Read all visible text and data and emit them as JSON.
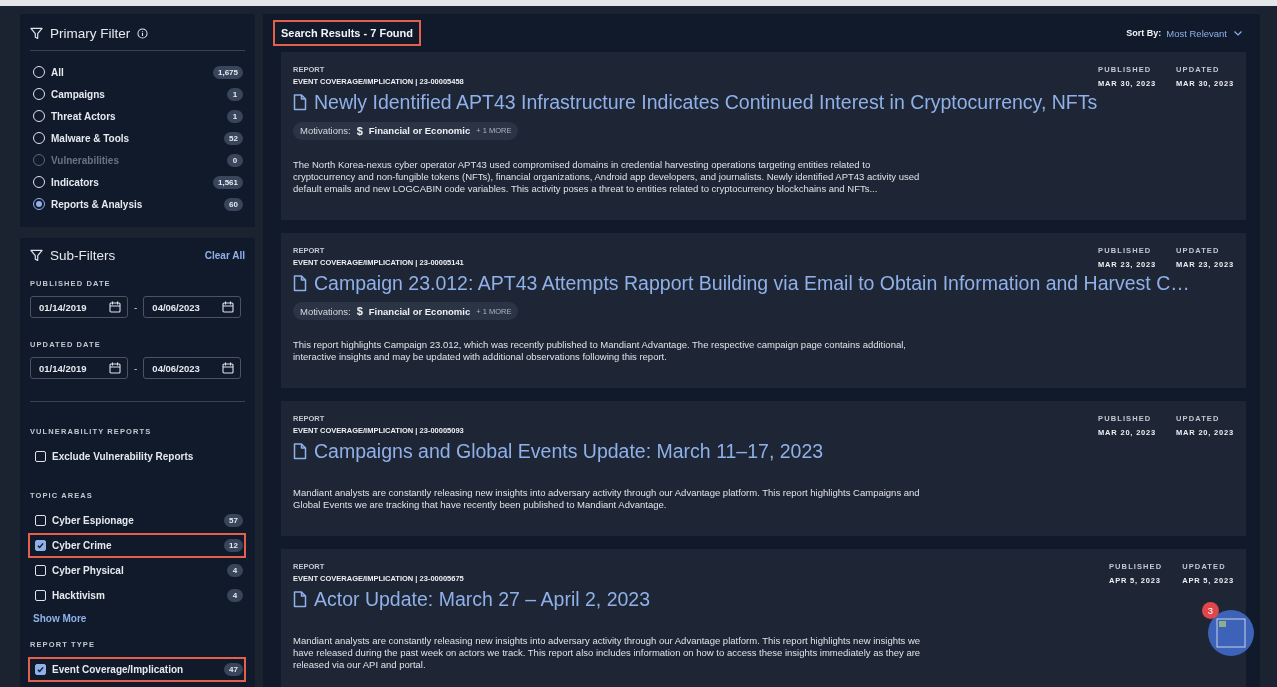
{
  "primary_filter": {
    "title": "Primary Filter",
    "options": [
      {
        "label": "All",
        "count": "1,675",
        "selected": false,
        "disabled": false
      },
      {
        "label": "Campaigns",
        "count": "1",
        "selected": false,
        "disabled": false
      },
      {
        "label": "Threat Actors",
        "count": "1",
        "selected": false,
        "disabled": false
      },
      {
        "label": "Malware & Tools",
        "count": "52",
        "selected": false,
        "disabled": false
      },
      {
        "label": "Vulnerabilities",
        "count": "0",
        "selected": false,
        "disabled": true
      },
      {
        "label": "Indicators",
        "count": "1,561",
        "selected": false,
        "disabled": false
      },
      {
        "label": "Reports & Analysis",
        "count": "60",
        "selected": true,
        "disabled": false
      }
    ]
  },
  "sub_filters": {
    "title": "Sub-Filters",
    "clear_all": "Clear All",
    "published_date": {
      "label": "PUBLISHED DATE",
      "from": "01/14/2019",
      "separator": "-",
      "to": "04/06/2023"
    },
    "updated_date": {
      "label": "UPDATED DATE",
      "from": "01/14/2019",
      "separator": "-",
      "to": "04/06/2023"
    },
    "vulnerability_reports": {
      "label": "VULNERABILITY REPORTS",
      "options": [
        {
          "label": "Exclude Vulnerability Reports",
          "checked": false,
          "highlighted": false
        }
      ]
    },
    "topic_areas": {
      "label": "TOPIC AREAS",
      "show_more": "Show More",
      "options": [
        {
          "label": "Cyber Espionage",
          "count": "57",
          "checked": false,
          "highlighted": false
        },
        {
          "label": "Cyber Crime",
          "count": "12",
          "checked": true,
          "highlighted": true
        },
        {
          "label": "Cyber Physical",
          "count": "4",
          "checked": false,
          "highlighted": false
        },
        {
          "label": "Hacktivism",
          "count": "4",
          "checked": false,
          "highlighted": false
        }
      ]
    },
    "report_type": {
      "label": "REPORT TYPE",
      "options": [
        {
          "label": "Event Coverage/Implication",
          "count": "47",
          "checked": true,
          "highlighted": true
        }
      ]
    }
  },
  "results": {
    "heading": "Search Results - 7 Found",
    "heading_highlighted": true,
    "sort_label": "Sort By:",
    "sort_value": "Most Relevant",
    "items": [
      {
        "type": "REPORT",
        "meta": "EVENT COVERAGE/IMPLICATION | 23-00005458",
        "title": "Newly Identified APT43 Infrastructure Indicates Continued Interest in Cryptocurrency, NFTs",
        "motivations": {
          "label": "Motivations:",
          "symbol": "$",
          "value": "Financial or Economic",
          "more": "+ 1 MORE"
        },
        "summary": "The North Korea-nexus cyber operator APT43 used compromised domains in credential harvesting operations targeting entities related to cryptocurrency and non-fungible tokens (NFTs), financial organizations, Android app developers, and journalists. Newly identified APT43 activity used default emails and new LOGCABIN code variables. This activity poses a threat to entities related to cryptocurrency blockchains and NFTs...",
        "published_label": "PUBLISHED",
        "published": "MAR 30, 2023",
        "updated_label": "UPDATED",
        "updated": "MAR 30, 2023"
      },
      {
        "type": "REPORT",
        "meta": "EVENT COVERAGE/IMPLICATION | 23-00005141",
        "title": "Campaign 23.012: APT43 Attempts Rapport Building via Email to Obtain Information and Harvest C…",
        "motivations": {
          "label": "Motivations:",
          "symbol": "$",
          "value": "Financial or Economic",
          "more": "+ 1 MORE"
        },
        "summary": "This report highlights Campaign 23.012, which was recently published to Mandiant Advantage. The respective campaign page contains additional, interactive insights and may be updated with additional observations following this report.",
        "published_label": "PUBLISHED",
        "published": "MAR 23, 2023",
        "updated_label": "UPDATED",
        "updated": "MAR 23, 2023"
      },
      {
        "type": "REPORT",
        "meta": "EVENT COVERAGE/IMPLICATION | 23-00005093",
        "title": "Campaigns and Global Events Update: March 11–17, 2023",
        "summary": "Mandiant analysts are constantly releasing new insights into adversary activity through our Advantage platform. This report highlights Campaigns and Global Events we are tracking that have recently been published to Mandiant Advantage.",
        "published_label": "PUBLISHED",
        "published": "MAR 20, 2023",
        "updated_label": "UPDATED",
        "updated": "MAR 20, 2023"
      },
      {
        "type": "REPORT",
        "meta": "EVENT COVERAGE/IMPLICATION | 23-00005675",
        "title": "Actor Update: March 27 – April 2, 2023",
        "summary": "Mandiant analysts are constantly releasing new insights into adversary activity through our Advantage platform. This report highlights new insights we have released during the past week on actors we track. This report also includes information on how to access these insights immediately as they are released via our API and portal.",
        "published_label": "PUBLISHED",
        "published": "APR 5, 2023",
        "updated_label": "UPDATED",
        "updated": "APR 5, 2023"
      }
    ]
  },
  "chat_button": {
    "badge": "3"
  }
}
